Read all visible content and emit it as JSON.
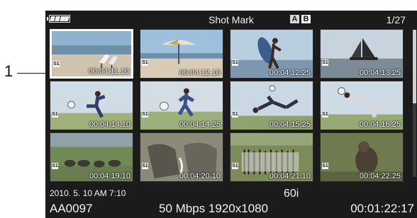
{
  "callout": {
    "number": "1"
  },
  "header": {
    "title": "Shot Mark",
    "slot_a": "A",
    "slot_b": "B",
    "page": "1/27",
    "battery_icon": "battery-icon"
  },
  "scrollbar": {
    "position_fraction": 0.0,
    "visible_fraction": 0.5
  },
  "thumbnails": [
    {
      "mark": "S1",
      "timecode": "00:04:11.10",
      "scene": "beach-chairs",
      "selected": true
    },
    {
      "mark": "S1",
      "timecode": "00:04:12.10",
      "scene": "beach-umbrella",
      "selected": false
    },
    {
      "mark": "S1",
      "timecode": "00:04:12.25",
      "scene": "surfer",
      "selected": false
    },
    {
      "mark": "S1",
      "timecode": "00:04:13.25",
      "scene": "sailboat",
      "selected": false
    },
    {
      "mark": "S1",
      "timecode": "00:04:14.10",
      "scene": "soccer-kick",
      "selected": false
    },
    {
      "mark": "S1",
      "timecode": "00:04:14.25",
      "scene": "soccer-run",
      "selected": false
    },
    {
      "mark": "S1",
      "timecode": "00:04:15.25",
      "scene": "bicycle-kick",
      "selected": false
    },
    {
      "mark": "S1",
      "timecode": "00:04:16.25",
      "scene": "goalkeeper-dive",
      "selected": false
    },
    {
      "mark": "S1",
      "timecode": "00:04:19.10",
      "scene": "elephant-herd",
      "selected": false
    },
    {
      "mark": "S1",
      "timecode": "00:04:20.10",
      "scene": "elephants-closeup",
      "selected": false
    },
    {
      "mark": "S1",
      "timecode": "00:04:21.10",
      "scene": "zebras",
      "selected": false
    },
    {
      "mark": "S1",
      "timecode": "00:04:22.25",
      "scene": "monkey",
      "selected": false
    }
  ],
  "footer": {
    "date": "2010.  5. 10 AM   7:10",
    "frame_rate": "60i",
    "clip_name": "AA0097",
    "bitrate_resolution": "50 Mbps 1920x1080",
    "duration": "00:01:22:17"
  }
}
